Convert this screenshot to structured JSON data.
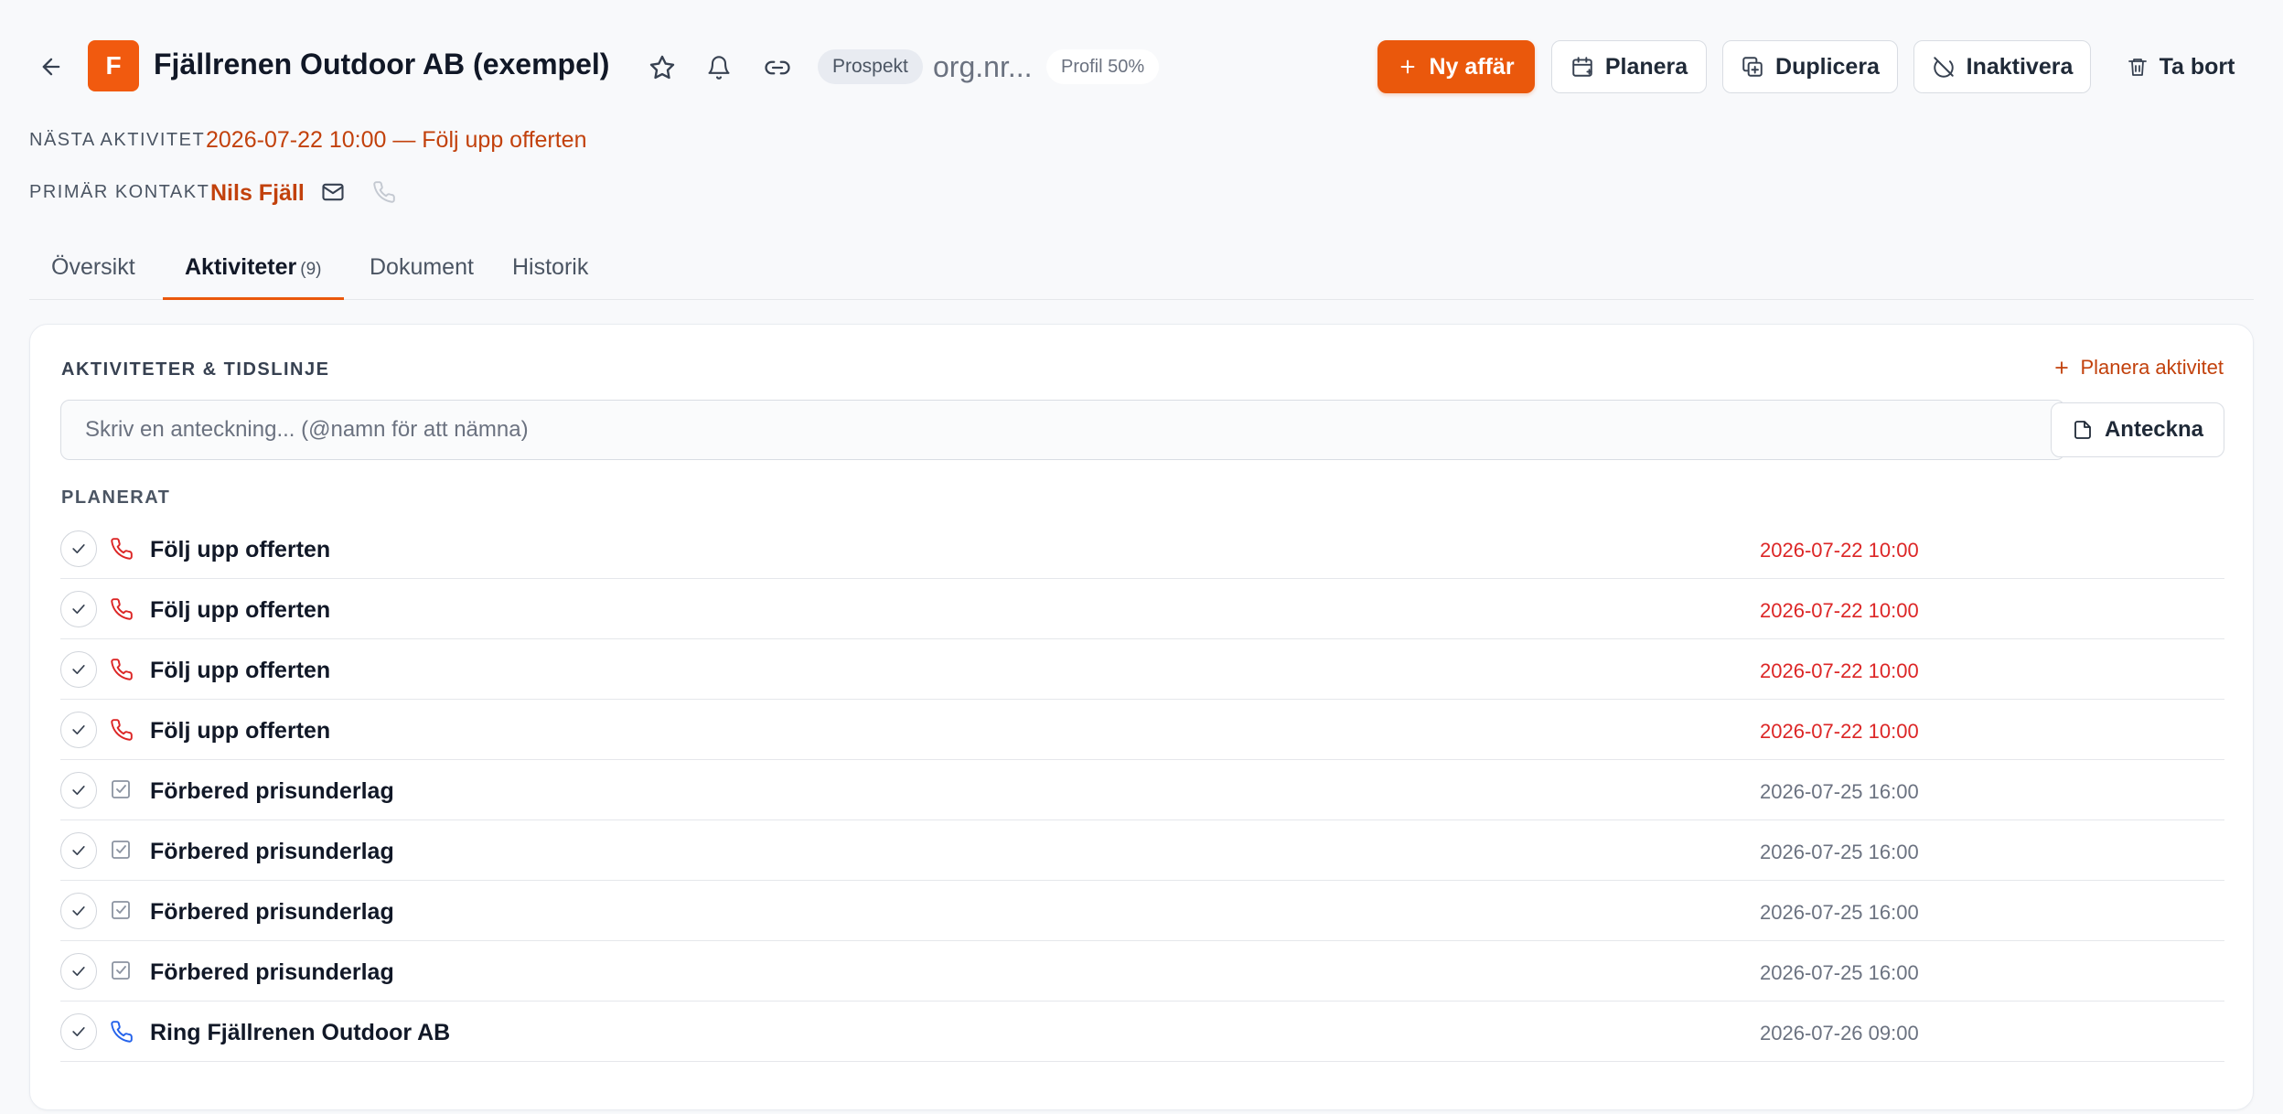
{
  "header": {
    "logo_letter": "F",
    "company_name": "Fjällrenen Outdoor AB (exempel)",
    "status_badge": "Prospekt",
    "org_nr": "org.nr...",
    "profile_badge": "Profil 50%",
    "actions": {
      "new_deal": "Ny affär",
      "plan": "Planera",
      "duplicate": "Duplicera",
      "deactivate": "Inaktivera",
      "delete": "Ta bort"
    }
  },
  "meta": {
    "next_activity_label": "Nästa aktivitet",
    "next_activity_value": "2026-07-22 10:00 — Följ upp offerten",
    "primary_contact_label": "Primär kontakt",
    "primary_contact_name": "Nils Fjäll"
  },
  "tabs": [
    {
      "label": "Översikt",
      "count": ""
    },
    {
      "label": "Aktiviteter",
      "count": "(9)"
    },
    {
      "label": "Dokument",
      "count": ""
    },
    {
      "label": "Historik",
      "count": ""
    }
  ],
  "activities_card": {
    "title": "AKTIVITETER & TIDSLINJE",
    "plan_link": "Planera aktivitet",
    "note_placeholder": "Skriv en anteckning... (@namn för att nämna)",
    "note_button": "Anteckna",
    "section_label": "PLANERAT",
    "items": [
      {
        "type": "phone-overdue",
        "title": "Följ upp offerten",
        "date": "2026-07-22 10:00"
      },
      {
        "type": "phone-overdue",
        "title": "Följ upp offerten",
        "date": "2026-07-22 10:00"
      },
      {
        "type": "phone-overdue",
        "title": "Följ upp offerten",
        "date": "2026-07-22 10:00"
      },
      {
        "type": "phone-overdue",
        "title": "Följ upp offerten",
        "date": "2026-07-22 10:00"
      },
      {
        "type": "task",
        "title": "Förbered prisunderlag",
        "date": "2026-07-25 16:00"
      },
      {
        "type": "task",
        "title": "Förbered prisunderlag",
        "date": "2026-07-25 16:00"
      },
      {
        "type": "task",
        "title": "Förbered prisunderlag",
        "date": "2026-07-25 16:00"
      },
      {
        "type": "task",
        "title": "Förbered prisunderlag",
        "date": "2026-07-25 16:00"
      },
      {
        "type": "phone",
        "title": "Ring Fjällrenen Outdoor AB",
        "date": "2026-07-26 09:00"
      }
    ]
  },
  "colors": {
    "accent": "#ea580c",
    "accent_text": "#c2410c",
    "overdue": "#dc2626",
    "phone_blue": "#2563eb",
    "muted": "#6b7280"
  }
}
